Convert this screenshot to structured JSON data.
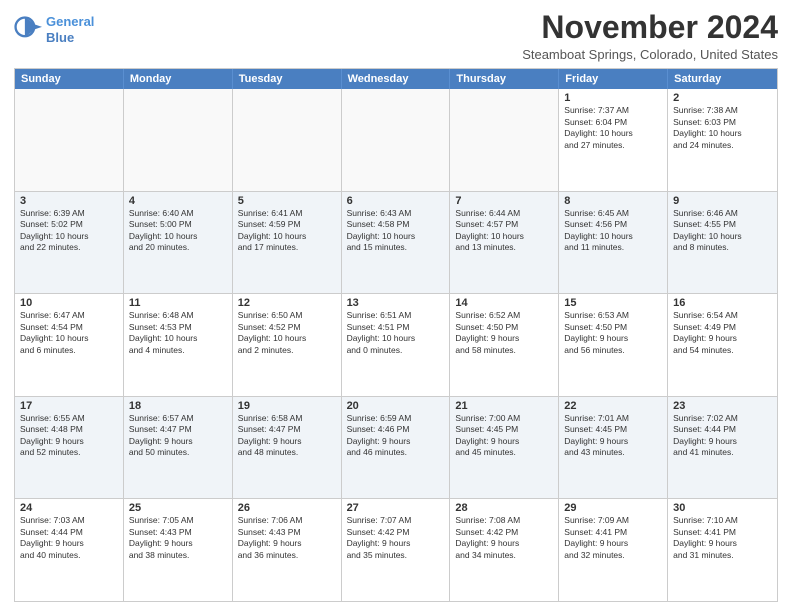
{
  "logo": {
    "line1": "General",
    "line2": "Blue"
  },
  "title": "November 2024",
  "location": "Steamboat Springs, Colorado, United States",
  "dayHeaders": [
    "Sunday",
    "Monday",
    "Tuesday",
    "Wednesday",
    "Thursday",
    "Friday",
    "Saturday"
  ],
  "weeks": [
    [
      {
        "day": "",
        "info": ""
      },
      {
        "day": "",
        "info": ""
      },
      {
        "day": "",
        "info": ""
      },
      {
        "day": "",
        "info": ""
      },
      {
        "day": "",
        "info": ""
      },
      {
        "day": "1",
        "info": "Sunrise: 7:37 AM\nSunset: 6:04 PM\nDaylight: 10 hours\nand 27 minutes."
      },
      {
        "day": "2",
        "info": "Sunrise: 7:38 AM\nSunset: 6:03 PM\nDaylight: 10 hours\nand 24 minutes."
      }
    ],
    [
      {
        "day": "3",
        "info": "Sunrise: 6:39 AM\nSunset: 5:02 PM\nDaylight: 10 hours\nand 22 minutes."
      },
      {
        "day": "4",
        "info": "Sunrise: 6:40 AM\nSunset: 5:00 PM\nDaylight: 10 hours\nand 20 minutes."
      },
      {
        "day": "5",
        "info": "Sunrise: 6:41 AM\nSunset: 4:59 PM\nDaylight: 10 hours\nand 17 minutes."
      },
      {
        "day": "6",
        "info": "Sunrise: 6:43 AM\nSunset: 4:58 PM\nDaylight: 10 hours\nand 15 minutes."
      },
      {
        "day": "7",
        "info": "Sunrise: 6:44 AM\nSunset: 4:57 PM\nDaylight: 10 hours\nand 13 minutes."
      },
      {
        "day": "8",
        "info": "Sunrise: 6:45 AM\nSunset: 4:56 PM\nDaylight: 10 hours\nand 11 minutes."
      },
      {
        "day": "9",
        "info": "Sunrise: 6:46 AM\nSunset: 4:55 PM\nDaylight: 10 hours\nand 8 minutes."
      }
    ],
    [
      {
        "day": "10",
        "info": "Sunrise: 6:47 AM\nSunset: 4:54 PM\nDaylight: 10 hours\nand 6 minutes."
      },
      {
        "day": "11",
        "info": "Sunrise: 6:48 AM\nSunset: 4:53 PM\nDaylight: 10 hours\nand 4 minutes."
      },
      {
        "day": "12",
        "info": "Sunrise: 6:50 AM\nSunset: 4:52 PM\nDaylight: 10 hours\nand 2 minutes."
      },
      {
        "day": "13",
        "info": "Sunrise: 6:51 AM\nSunset: 4:51 PM\nDaylight: 10 hours\nand 0 minutes."
      },
      {
        "day": "14",
        "info": "Sunrise: 6:52 AM\nSunset: 4:50 PM\nDaylight: 9 hours\nand 58 minutes."
      },
      {
        "day": "15",
        "info": "Sunrise: 6:53 AM\nSunset: 4:50 PM\nDaylight: 9 hours\nand 56 minutes."
      },
      {
        "day": "16",
        "info": "Sunrise: 6:54 AM\nSunset: 4:49 PM\nDaylight: 9 hours\nand 54 minutes."
      }
    ],
    [
      {
        "day": "17",
        "info": "Sunrise: 6:55 AM\nSunset: 4:48 PM\nDaylight: 9 hours\nand 52 minutes."
      },
      {
        "day": "18",
        "info": "Sunrise: 6:57 AM\nSunset: 4:47 PM\nDaylight: 9 hours\nand 50 minutes."
      },
      {
        "day": "19",
        "info": "Sunrise: 6:58 AM\nSunset: 4:47 PM\nDaylight: 9 hours\nand 48 minutes."
      },
      {
        "day": "20",
        "info": "Sunrise: 6:59 AM\nSunset: 4:46 PM\nDaylight: 9 hours\nand 46 minutes."
      },
      {
        "day": "21",
        "info": "Sunrise: 7:00 AM\nSunset: 4:45 PM\nDaylight: 9 hours\nand 45 minutes."
      },
      {
        "day": "22",
        "info": "Sunrise: 7:01 AM\nSunset: 4:45 PM\nDaylight: 9 hours\nand 43 minutes."
      },
      {
        "day": "23",
        "info": "Sunrise: 7:02 AM\nSunset: 4:44 PM\nDaylight: 9 hours\nand 41 minutes."
      }
    ],
    [
      {
        "day": "24",
        "info": "Sunrise: 7:03 AM\nSunset: 4:44 PM\nDaylight: 9 hours\nand 40 minutes."
      },
      {
        "day": "25",
        "info": "Sunrise: 7:05 AM\nSunset: 4:43 PM\nDaylight: 9 hours\nand 38 minutes."
      },
      {
        "day": "26",
        "info": "Sunrise: 7:06 AM\nSunset: 4:43 PM\nDaylight: 9 hours\nand 36 minutes."
      },
      {
        "day": "27",
        "info": "Sunrise: 7:07 AM\nSunset: 4:42 PM\nDaylight: 9 hours\nand 35 minutes."
      },
      {
        "day": "28",
        "info": "Sunrise: 7:08 AM\nSunset: 4:42 PM\nDaylight: 9 hours\nand 34 minutes."
      },
      {
        "day": "29",
        "info": "Sunrise: 7:09 AM\nSunset: 4:41 PM\nDaylight: 9 hours\nand 32 minutes."
      },
      {
        "day": "30",
        "info": "Sunrise: 7:10 AM\nSunset: 4:41 PM\nDaylight: 9 hours\nand 31 minutes."
      }
    ]
  ]
}
